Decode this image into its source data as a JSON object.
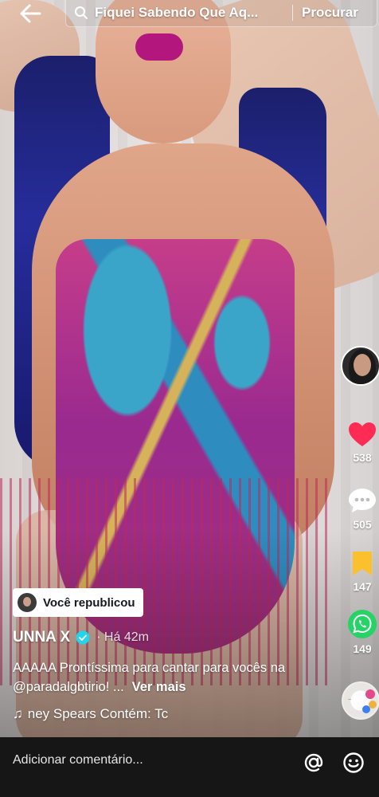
{
  "search": {
    "query": "Fiquei Sabendo Que Aq...",
    "submit_label": "Procurar"
  },
  "rail": {
    "likes": "538",
    "comments": "505",
    "saves": "147",
    "shares": "149",
    "like_color": "#fe2c55",
    "save_color": "#fbc02d",
    "share_color": "#25d366"
  },
  "post": {
    "repost_label": "Você republicou",
    "username": "UNNA X",
    "timestamp": "· Há 42m",
    "caption": "AAAAA Prontíssima para cantar para vocês na @paradalgbtirio! ...",
    "see_more": "Ver mais",
    "music": "ney Spears    Contém: Tc"
  },
  "comment_bar": {
    "placeholder": "Adicionar comentário..."
  }
}
